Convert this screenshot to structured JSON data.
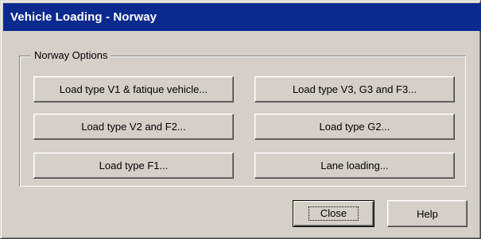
{
  "window": {
    "title": "Vehicle Loading - Norway"
  },
  "group": {
    "legend": "Norway Options"
  },
  "buttons": {
    "v1_fatigue": "Load type V1 & fatique vehicle...",
    "v3_g3_f3": "Load type V3, G3 and F3...",
    "v2_f2": "Load type V2 and F2...",
    "g2": "Load type G2...",
    "f1": "Load type F1...",
    "lane": "Lane loading..."
  },
  "footer": {
    "close": "Close",
    "help": "Help"
  },
  "colors": {
    "titlebar": "#0b2a8e",
    "face": "#d4d0c8"
  }
}
